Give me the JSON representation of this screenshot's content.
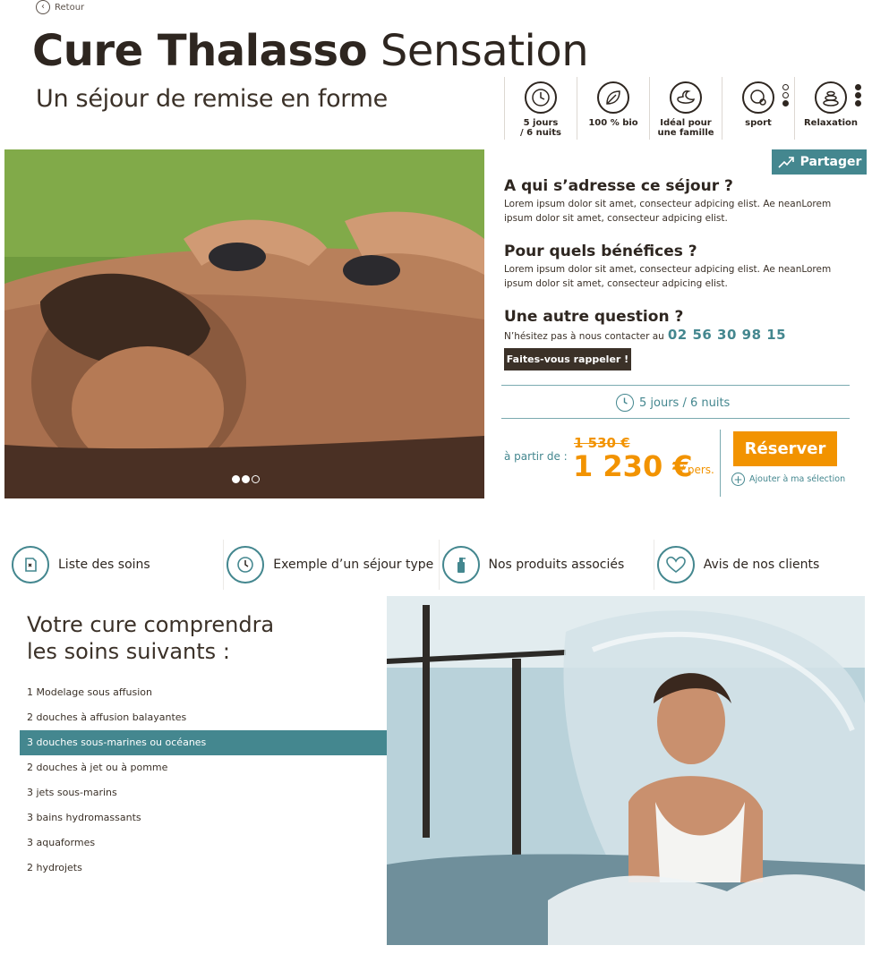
{
  "nav": {
    "back_label": "Retour"
  },
  "header": {
    "title_bold": "Cure Thalasso",
    "title_light": "Sensation",
    "subtitle": "Un séjour de remise en forme"
  },
  "features": [
    {
      "line1": "5 jours",
      "line2": "/ 6 nuits",
      "icon": "clock-icon"
    },
    {
      "line1": "100 % bio",
      "line2": "",
      "icon": "leaf-icon"
    },
    {
      "line1": "Idéal pour",
      "line2": "une famille",
      "icon": "duck-icon"
    },
    {
      "line1": "sport",
      "line2": "",
      "icon": "sport-icon",
      "level": 1,
      "max": 3
    },
    {
      "line1": "Relaxation",
      "line2": "",
      "icon": "stones-icon",
      "level": 3,
      "max": 3
    }
  ],
  "info": {
    "share_label": "Partager",
    "q1_title": "A qui s’adresse ce séjour ?",
    "q1_text": "Lorem ipsum dolor sit amet, consecteur adpicing elist. Ae neanLorem ipsum dolor sit amet, consecteur adpicing elist.",
    "q2_title": "Pour quels bénéfices ?",
    "q2_text": "Lorem ipsum dolor sit amet, consecteur adpicing elist. Ae neanLorem ipsum dolor sit amet, consecteur adpicing elist.",
    "q3_title": "Une autre question ?",
    "contact_text": "N’hésitez pas à nous contacter au",
    "phone": "02 56 30 98 15",
    "callback_label": "Faites-vous rappeler !"
  },
  "offer": {
    "duration": "5 jours / 6 nuits",
    "from_label": "à partir de :",
    "old_price": "1 530 €",
    "price": "1 230 €",
    "per_label": "/ pers.",
    "reserve_label": "Réserver",
    "add_selection_label": "Ajouter à ma sélection"
  },
  "carousel": {
    "slides": 3,
    "active": 2
  },
  "tabs": [
    {
      "label": "Liste des soins",
      "icon": "document-icon"
    },
    {
      "label": "Exemple d’un séjour type",
      "icon": "clock-icon"
    },
    {
      "label": "Nos produits associés",
      "icon": "bottle-icon"
    },
    {
      "label": "Avis de nos clients",
      "icon": "heart-icon"
    }
  ],
  "soins": {
    "title_line1": "Votre cure comprendra",
    "title_line2": "les soins suivants :",
    "items": [
      "1 Modelage sous affusion",
      "2 douches à affusion balayantes",
      "3 douches sous-marines ou océanes",
      "2 douches à jet ou à pomme",
      "3 jets sous-marins",
      "3 bains hydromassants",
      "3 aquaformes",
      "2 hydrojets"
    ],
    "active_index": 2
  },
  "colors": {
    "teal": "#44878f",
    "orange": "#f29300",
    "dark": "#3b3128"
  }
}
